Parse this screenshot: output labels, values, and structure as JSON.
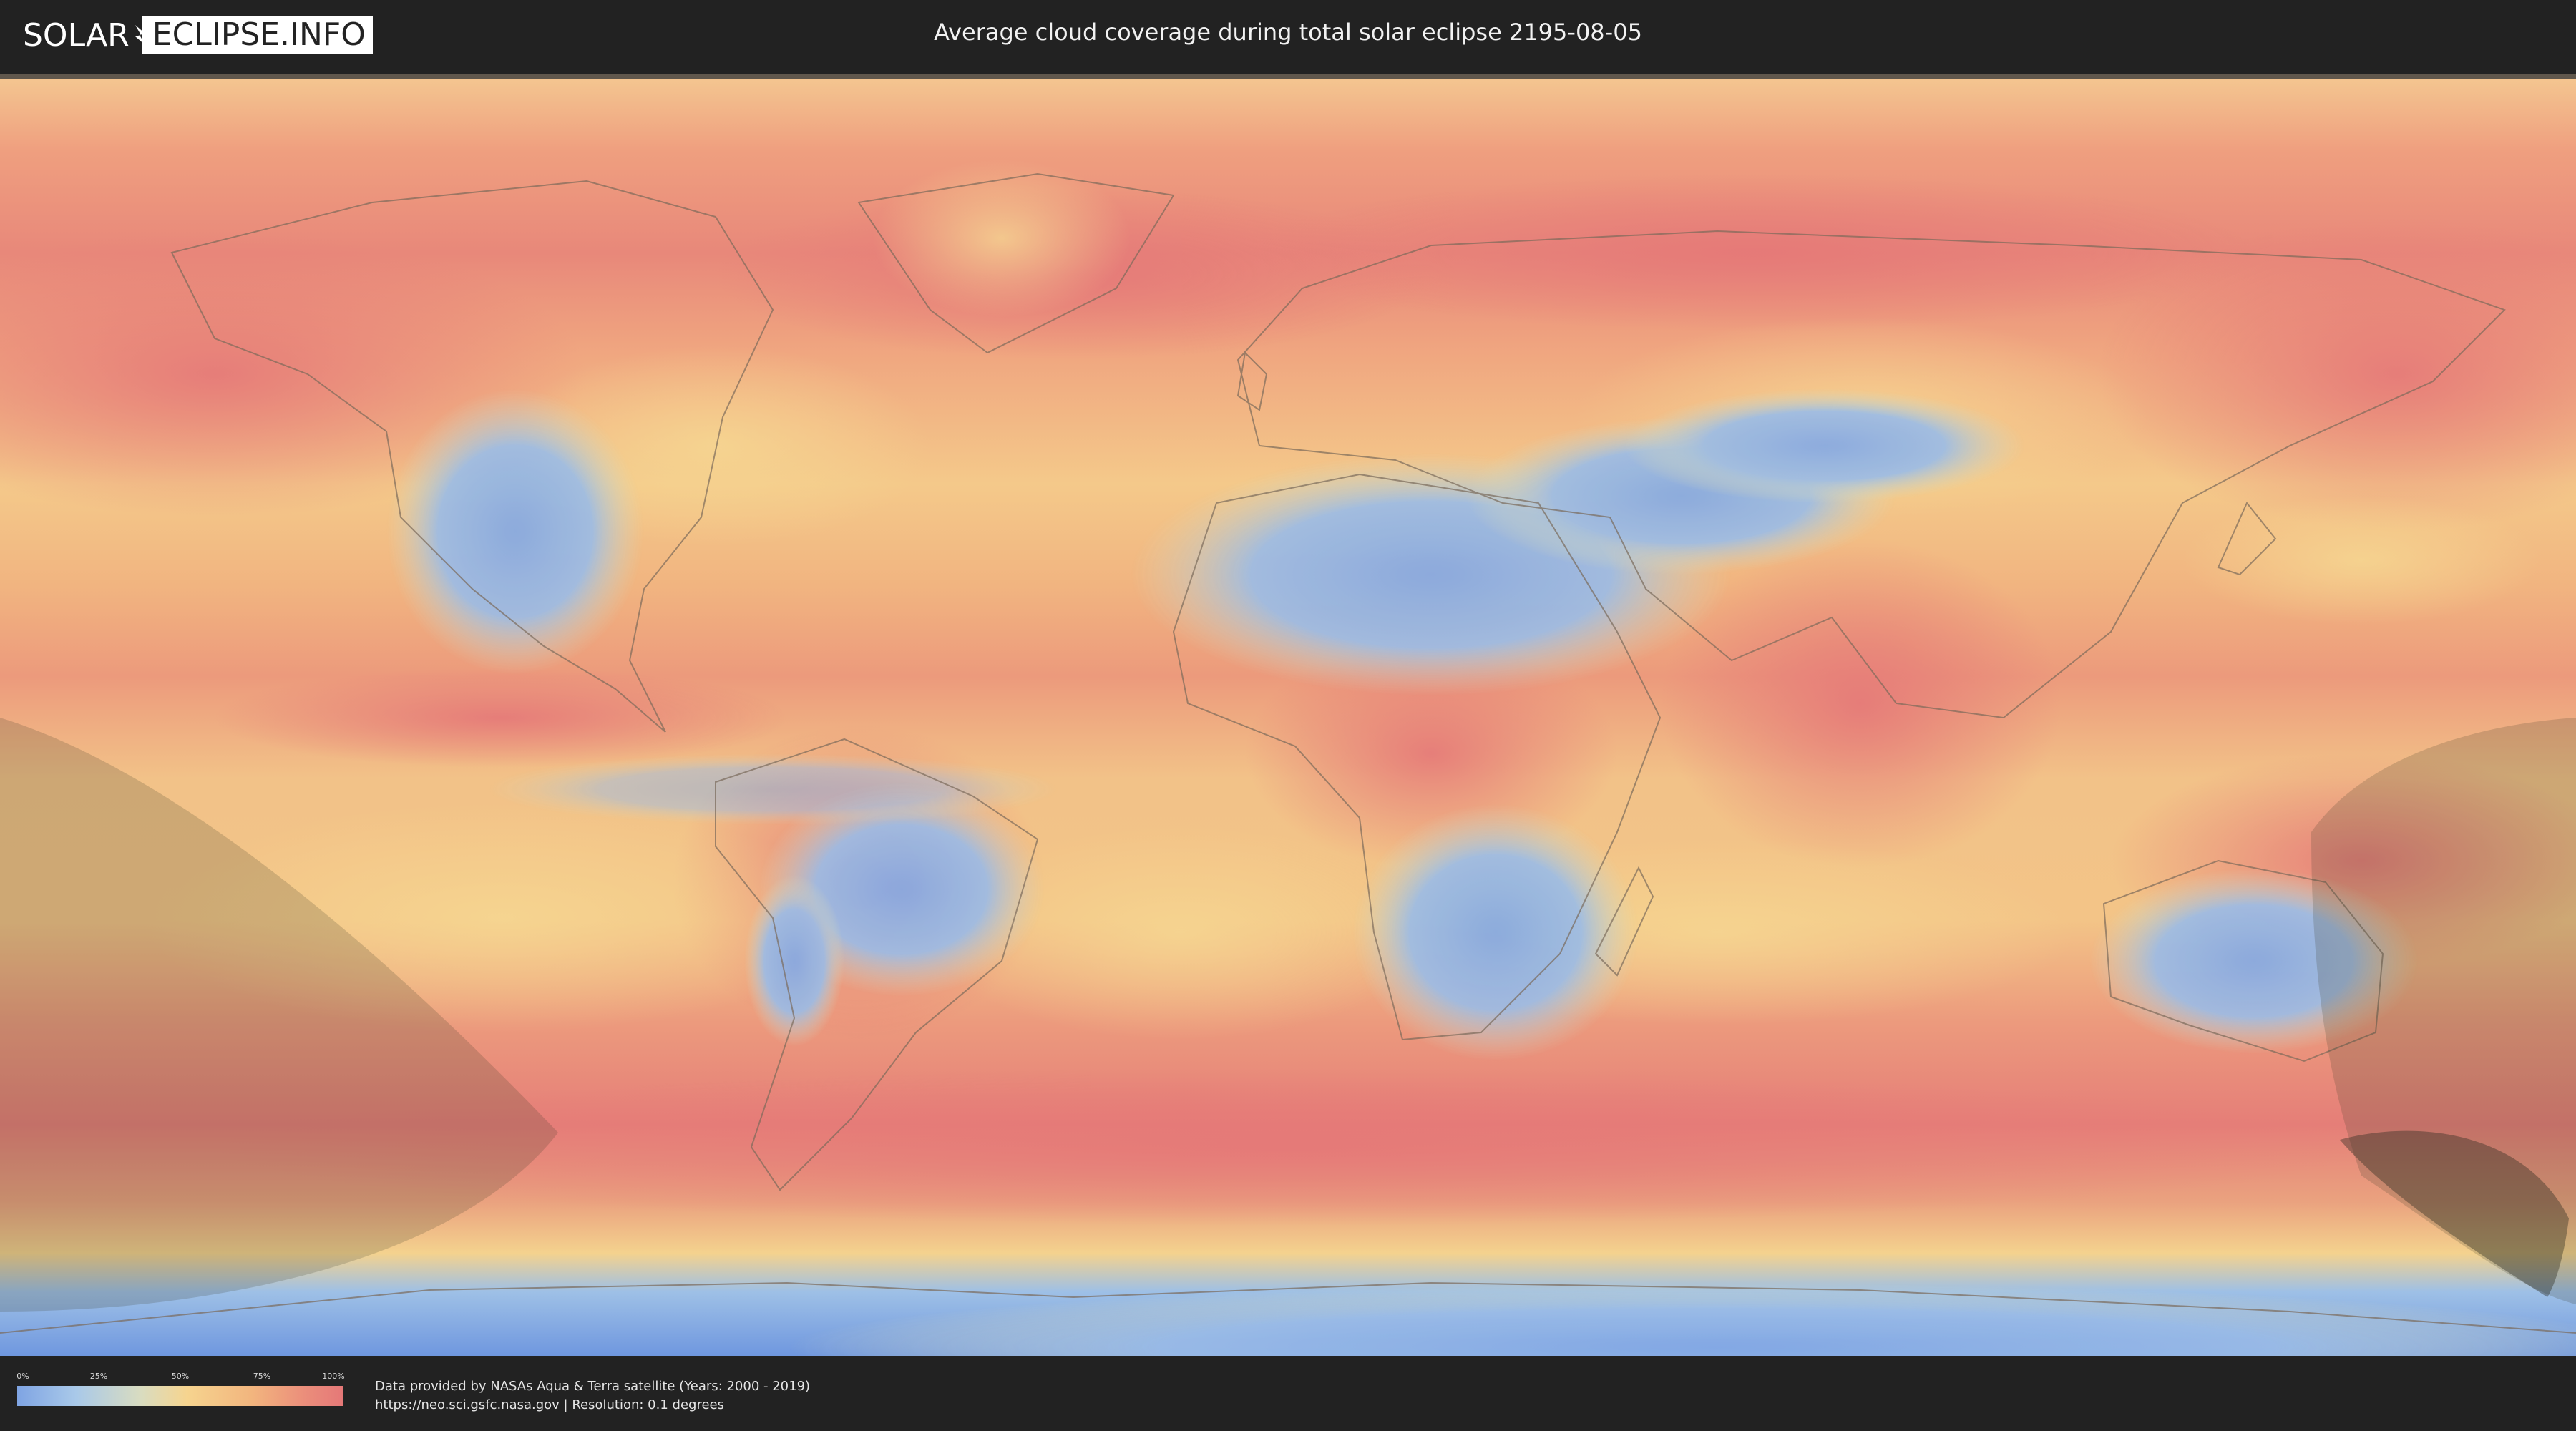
{
  "header": {
    "logo_left": "SOLAR",
    "logo_right": "ECLIPSE.INFO",
    "title": "Average cloud coverage during total solar eclipse 2195-08-05"
  },
  "map": {
    "colors": {
      "ocean_cloudy": "#e8887a",
      "ocean_mid": "#f2b07f",
      "clear": "#84a9e4",
      "partly": "#f4d392",
      "border": "#7a6a5a",
      "eclipse_shadow": "#3a3a2a",
      "frame": "#3b3b3b"
    },
    "projection": "equirectangular",
    "overlay": "eclipse shadow regions (Pacific, left and right edges)"
  },
  "legend": {
    "ticks": [
      "0%",
      "25%",
      "50%",
      "75%",
      "100%"
    ],
    "colors": {
      "low": "#7fa4e3",
      "mid": "#f6d48f",
      "high": "#e57878"
    }
  },
  "credits": {
    "line1": "Data provided by NASAs Aqua & Terra satellite (Years: 2000 - 2019)",
    "line2": "https://neo.sci.gsfc.nasa.gov | Resolution: 0.1 degrees"
  }
}
